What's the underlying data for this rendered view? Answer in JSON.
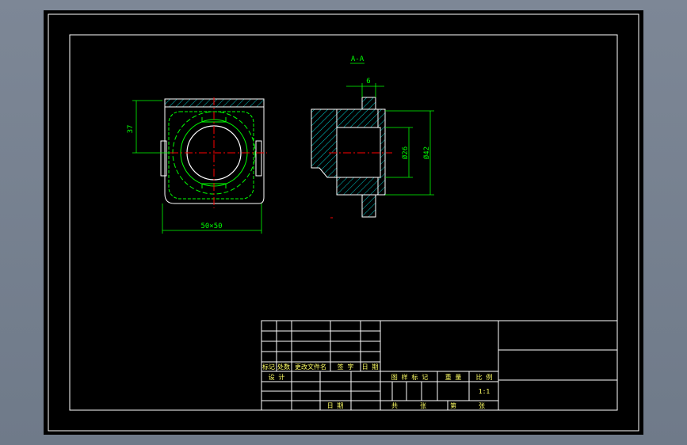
{
  "drawing": {
    "section_label": "A-A",
    "dimensions": {
      "height": "37",
      "width": "50×50",
      "flange": "6",
      "inner_dia": "Ø26",
      "outer_dia": "Ø42"
    },
    "title_block": {
      "rev_headers": [
        "标记",
        "处数",
        "更改文件名",
        "签 字",
        "日 期"
      ],
      "designer_label": "设 计",
      "date_label": "日 期",
      "info_headers": [
        "图 样 标 记",
        "重 量",
        "比 例"
      ],
      "scale": "1:1",
      "sheet_total": "共",
      "sheet_unit1": "张",
      "sheet_label": "第",
      "sheet_unit2": "张"
    }
  },
  "colors": {
    "paper": "#000000",
    "outline": "#ffffff",
    "dimension": "#00ff00",
    "hatch": "#00ffff",
    "center": "#ff0000"
  }
}
